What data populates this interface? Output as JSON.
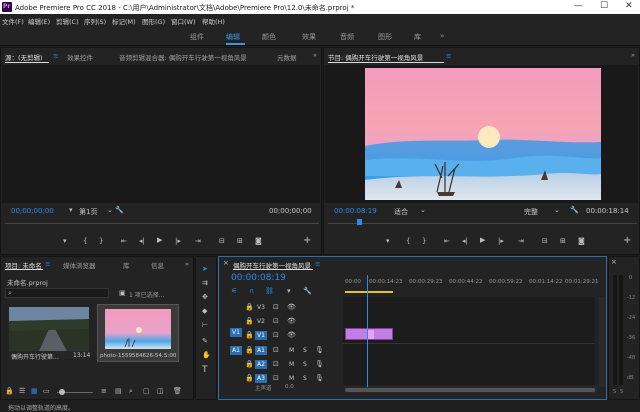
{
  "app": {
    "title": "Adobe Premiere Pro CC 2018 - C:\\用户\\Administrator\\文档\\Adobe\\Premiere Pro\\12.0\\未命名.prproj *",
    "logo_text": "Pr"
  },
  "window": {
    "min": "—",
    "max": "☐",
    "close": "✕"
  },
  "menu": [
    "文件(F)",
    "编辑(E)",
    "剪辑(C)",
    "序列(S)",
    "标记(M)",
    "图形(G)",
    "窗口(W)",
    "帮助(H)"
  ],
  "workspaces": [
    "组件",
    "编辑",
    "颜色",
    "效果",
    "音频",
    "图形",
    "库"
  ],
  "workspace_more": "»",
  "colors": {
    "accent": "#3c95e6",
    "timecode": "#2d8ceb",
    "clip": "#c27ee0",
    "bg": "#232323"
  },
  "source": {
    "tabs": [
      "源：(无剪辑)",
      "效果控件",
      "音频剪辑混合器: 偶购开车行驶第一视角风景",
      "元数据"
    ],
    "tab_menu": "≡",
    "timecode_left": "00;00;00;00",
    "page": "第1页",
    "timecode_right": "00;00;00;00"
  },
  "program": {
    "tab": "节目: 偶购开车行驶第一视角风景",
    "tab_menu": "≡",
    "timecode_left": "00:00:08:19",
    "fit": "适合",
    "quality": "完整",
    "timecode_right": "00:00:18:14"
  },
  "project": {
    "tabs": [
      "项目: 未命名",
      "媒体浏览器",
      "库",
      "信息"
    ],
    "file": "未命名.prproj",
    "search_placeholder": "",
    "selection": "1 项已选择...",
    "items": [
      {
        "name": "偶购开车行驶第...",
        "duration": "13:14"
      },
      {
        "name": "photo-1559584626-54...",
        "duration": "5:00"
      }
    ]
  },
  "timeline": {
    "tab": "偶购开车行驶第一视角风景",
    "tab_menu": "≡",
    "timecode": "00:00:08:19",
    "ruler": [
      "00:00",
      "00:00:14:23",
      "00:00:29:23",
      "00:00:44:22",
      "00:00:59:22",
      "00:01:14:22",
      "00:01:29:21"
    ],
    "video_tracks": [
      "V3",
      "V2",
      "V1"
    ],
    "audio_tracks": [
      "A1",
      "A2",
      "A3"
    ],
    "source_patch_v": "V1",
    "source_patch_a": "A1",
    "track_m": "M",
    "track_s": "S",
    "master": "主声道",
    "master_value": "0.0",
    "playhead_fraction": 0.09
  },
  "status": "拖动以调整轨道的高度。",
  "audio_meter": {
    "labels": [
      "0",
      "-12",
      "-24",
      "-36",
      "-48",
      "dB"
    ],
    "solo": "S"
  }
}
